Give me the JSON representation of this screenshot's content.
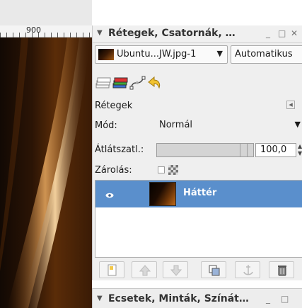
{
  "ruler": {
    "label": "900"
  },
  "layers_dock": {
    "title": "Rétegek, Csatornák, …",
    "minimize_glyph": "_",
    "maximize_glyph": "□",
    "close_glyph": "✕",
    "image_selector": "Ubuntu...JW.jpg-1",
    "auto_button": "Automatikus",
    "tabs": [
      "layers-tab",
      "channels-tab",
      "paths-tab",
      "undo-history-tab"
    ],
    "section_label": "Rétegek",
    "mode_label": "Mód:",
    "mode_value": "Normál",
    "opacity_label": "Átlátszatl.:",
    "opacity_value": "100,0",
    "lock_label": "Zárolás:",
    "layers": [
      {
        "name": "Háttér",
        "visible": true,
        "selected": true
      }
    ],
    "bottom_buttons": [
      "new-layer",
      "raise-layer",
      "lower-layer",
      "duplicate-layer",
      "anchor-layer",
      "delete-layer"
    ]
  },
  "brushes_dock": {
    "title": "Ecsetek, Minták, Színát…",
    "minimize_glyph": "_",
    "maximize_glyph": "□"
  },
  "colors": {
    "selection": "#5a8fcc",
    "panel_bg": "#efefef"
  }
}
